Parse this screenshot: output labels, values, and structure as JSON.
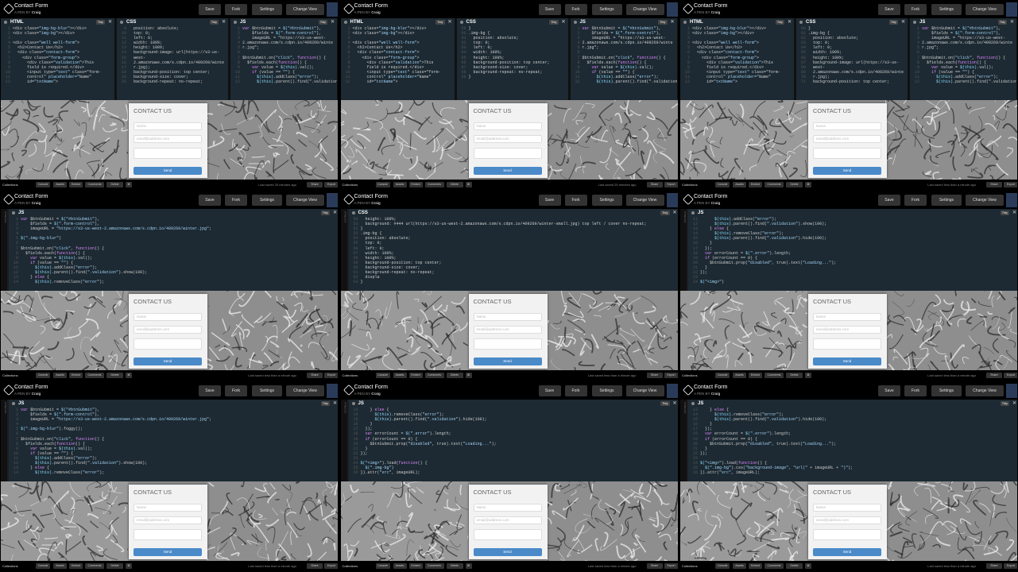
{
  "project": {
    "title": "Contact Form",
    "author_prefix": "A PEN BY",
    "author": "Craig"
  },
  "toolbar": {
    "save": "Save",
    "fork": "Fork",
    "settings": "Settings",
    "change_view": "Change View"
  },
  "editors": {
    "html": "HTML",
    "css": "CSS",
    "js": "JS",
    "tidy": "Tidy",
    "close": "✕"
  },
  "form": {
    "title": "CONTACT US",
    "name_placeholder": "Name",
    "email_placeholder": "email@address.com",
    "send": "Send"
  },
  "footer": {
    "collections": "Collections",
    "console": "Console",
    "assets": "Assets",
    "embed": "Embed",
    "comments": "Comments",
    "delete": "Delete",
    "shortcut": "⌘",
    "share": "Share",
    "export": "Export"
  },
  "saved_statuses": [
    "Last saved 25 minutes ago",
    "Last saved 25 minutes ago",
    "Last saved less than a minute ago",
    "Last saved less than a minute ago",
    "Last saved less than a minute ago",
    "Last saved less than a minute ago",
    "Last saved less than a minute ago",
    "Last saved less than a minute ago",
    "Last saved less than a minute ago"
  ],
  "side_labels": {
    "html": "HTML",
    "css": "CSS"
  },
  "code": {
    "html_full": [
      "<div class=\"img-bg-blur\"></div>",
      "<div class=\"img-bg\"></div>",
      "",
      "<div class=\"well well-form\">",
      "  <h2>Contact Us</h2>",
      "  <div class=\"contact-form\">",
      "    <div class=\"form-group\">",
      "      <div class=\"validation\">This",
      "      field is required.</div>",
      "      <input type=\"text\" class=\"form-",
      "      control\" placeholder=\"Name\"",
      "      id=\"txtName\">"
    ],
    "css_p1": [
      "  position: absolute;",
      "  top: 0;",
      "  left: 0;",
      "  width: 100%;",
      "  height: 100%;",
      "  background-image: url(https://s3-us-",
      "  west-",
      "  2.amazonaws.com/s.cdpn.io/409269/winte",
      "  r.jpg);",
      "  background-position: top center;",
      "  background-size: cover;",
      "  background-repeat: no-repeat;"
    ],
    "css_p2": [
      "}",
      ".img-bg {",
      "  position: absolute;",
      "  top: 0;",
      "  left: 0;",
      "  width: 100%;",
      "  height: 100%;",
      "  background-position: top center;",
      "  background-size: cover;",
      "  background-repeat: no-repeat;",
      "}"
    ],
    "css_p3": [
      "}",
      ".img-bg {",
      "  position: absolute;",
      "  top: 0;",
      "  left: 0;",
      "  width: 100%;",
      "  height: 100%;",
      "  background-image: url(https://s3-us-",
      "  west-",
      "  2.amazonaws.com/s.cdpn.io/409269/winte",
      "  r.jpg);",
      "  background-position: top center;"
    ],
    "js_narrow": [
      "var $btnSubmit = $(\"#btnSubmit\"),",
      "    $fields = $(\".form-control\"),",
      "    imageURL = \"https://s3-us-west-",
      "2.amazonaws.com/s.cdpn.io/409269/winte",
      "r.jpg\";",
      "",
      "$btnSubmit.on(\"click\", function() {",
      "  $fields.each(function() {",
      "    var value = $(this).val();",
      "    if (value == \"\") {",
      "      $(this).addClass(\"error\");",
      "      $(this).parent().find(\".validation"
    ],
    "js_w4": [
      "var $btnSubmit = $(\"#btnSubmit\"),",
      "    $fields = $(\".form-control\"),",
      "    imageURL = \"https://s3-us-west-2.amazonaws.com/s.cdpn.io/409269/winter.jpg\";",
      "",
      "$(\".img-bg-blur\")",
      "",
      "$btnSubmit.on(\"click\", function() {",
      "  $fields.each(function() {",
      "    var value = $(this).val();",
      "    if (value == \"\") {",
      "      $(this).addClass(\"error\");",
      "      $(this).parent().find(\".validation\").show(100);",
      "    } else {",
      "      $(this).removeClass(\"error\");"
    ],
    "css_w5": [
      "  height: 100%;",
      "  background: #444 url(https://s3-us-west-2.amazonaws.com/s.cdpn.io/409269/winter-small.jpg) top left / cover no-repeat;",
      "}",
      ".img-bg {",
      "  position: absolute;",
      "  top: 0;",
      "  left: 0;",
      "  width: 100%;",
      "  height: 100%;",
      "  background-position: top center;",
      "  background-size: cover;",
      "  background-repeat: no-repeat;",
      "  displa",
      "}"
    ],
    "js_w6": [
      "      $(this).addClass(\"error\");",
      "      $(this).parent().find(\".validation\").show(100);",
      "    } else {",
      "      $(this).removeClass(\"error\");",
      "      $(this).parent().find(\".validation\").hide(100);",
      "    }",
      "  });",
      "  var errorCount = $(\".error\").length;",
      "  if (errorCount == 0) {",
      "    $btnSubmit.prop(\"disabled\", true).text(\"Loading...\");",
      "  }",
      "});",
      "",
      "$(\"<img>\")"
    ],
    "js_w7": [
      "var $btnSubmit = $(\"#btnSubmit\"),",
      "    $fields = $(\".form-control\"),",
      "    imageURL = \"https://s3-us-west-2.amazonaws.com/s.cdpn.io/409269/winter.jpg\";",
      "",
      "$(\".img-bg-blur\").foggy();",
      "",
      "$btnSubmit.on(\"click\", function() {",
      "  $fields.each(function() {",
      "    var value = $(this).val();",
      "    if (value == \"\") {",
      "      $(this).addClass(\"error\");",
      "      $(this).parent().find(\".validation\").show(100);",
      "    } else {",
      "      $(this).removeClass(\"error\");"
    ],
    "js_w8": [
      "    } else {",
      "      $(this).removeClass(\"error\");",
      "      $(this).parent().find(\".validation\").hide(100);",
      "    }",
      "  });",
      "  var errorCount = $(\".error\").length;",
      "  if (errorCount == 0) {",
      "    $btnSubmit.prop(\"disabled\", true).text(\"Loading...\");",
      "  }",
      "});",
      "",
      "$(\"<img>\").load(function() {",
      "  $(\".img-bg\")",
      "}).attr(\"src\", imageURL);"
    ],
    "js_w9": [
      "    } else {",
      "      $(this).removeClass(\"error\");",
      "      $(this).parent().find(\".validation\").hide(100);",
      "    }",
      "  });",
      "  var errorCount = $(\".error\").length;",
      "  if (errorCount == 0) {",
      "    $btnSubmit.prop(\"disabled\", true).text(\"Loading...\");",
      "  }",
      "});",
      "",
      "$(\"<img>\").load(function() {",
      "  $(\".img-bg\").css(\"background-image\", \"url(\" + imageURL + \")\");",
      "}).attr(\"src\", imageURL);"
    ]
  }
}
